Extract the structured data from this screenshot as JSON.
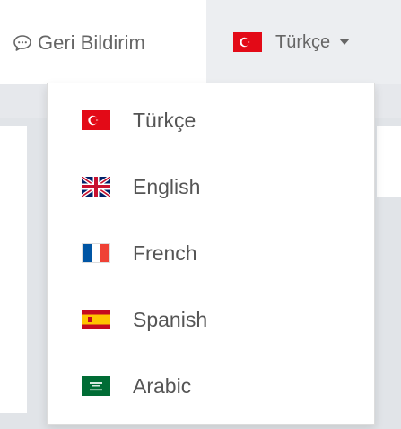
{
  "header": {
    "feedback_label": "Geri Bildirim",
    "feedback_icon": "speech-bubble-icon",
    "language_toggle": {
      "label": "Türkçe",
      "flag": "tr-flag-icon",
      "caret": "caret-down-icon"
    }
  },
  "language_menu": {
    "items": [
      {
        "label": "Türkçe",
        "flag": "tr-flag-icon"
      },
      {
        "label": "English",
        "flag": "gb-flag-icon"
      },
      {
        "label": "French",
        "flag": "fr-flag-icon"
      },
      {
        "label": "Spanish",
        "flag": "es-flag-icon"
      },
      {
        "label": "Arabic",
        "flag": "sa-flag-icon"
      }
    ]
  },
  "colors": {
    "turkey_red": "#e30a17",
    "uk_blue": "#012169",
    "uk_red": "#c8102e",
    "france_blue": "#0055a4",
    "france_red": "#ef4135",
    "spain_red": "#c60b1e",
    "spain_yellow": "#ffc400",
    "saudi_green": "#006c35"
  }
}
